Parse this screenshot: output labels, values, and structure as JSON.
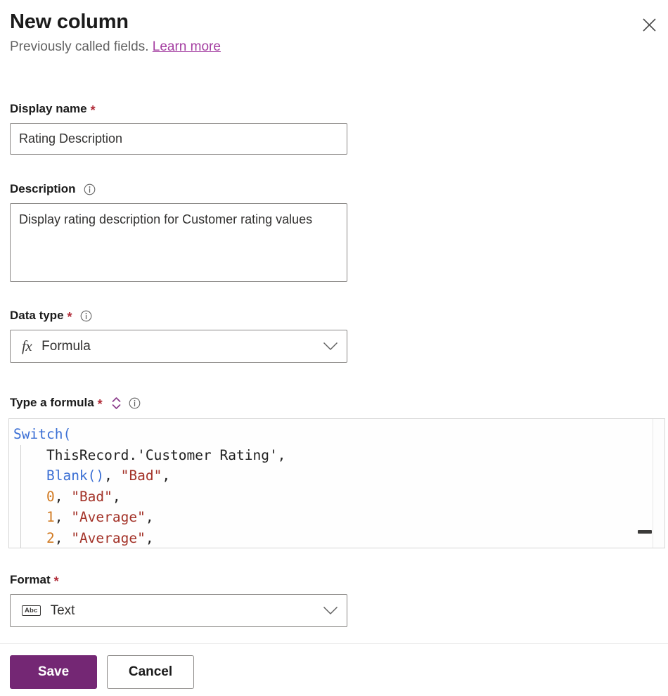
{
  "dialog": {
    "title": "New column",
    "subtitle_text": "Previously called fields.",
    "subtitle_link": "Learn more",
    "close_icon": "close-icon"
  },
  "colors": {
    "accent_purple": "#742774",
    "link_purple": "#a43ea1",
    "required_red": "#b02a37",
    "code_function": "#3b6fd4",
    "code_string": "#a33228",
    "code_number": "#d17a22",
    "code_plain": "#1f1f1f",
    "border_gray": "#8a8886"
  },
  "fields": {
    "display_name": {
      "label": "Display name",
      "required_marker": "*",
      "value": "Rating Description",
      "placeholder": ""
    },
    "description": {
      "label": "Description",
      "info_icon": "info-icon",
      "value": "Display rating description for Customer rating values",
      "placeholder": ""
    },
    "data_type": {
      "label": "Data type",
      "required_marker": "*",
      "info_icon": "info-icon",
      "selected": "Formula",
      "selected_icon_glyph": "fx",
      "selected_icon_name": "formula-fx-icon",
      "chevron_icon": "chevron-down-icon"
    },
    "formula": {
      "label": "Type a formula",
      "required_marker": "*",
      "expand_icon": "expand-collapse-icon",
      "info_icon": "info-icon",
      "lines": [
        [
          {
            "t": "Switch(",
            "c": "fn"
          }
        ],
        [
          {
            "t": "    ThisRecord.'Customer Rating',",
            "c": "plain"
          }
        ],
        [
          {
            "t": "    ",
            "c": "plain"
          },
          {
            "t": "Blank()",
            "c": "fn"
          },
          {
            "t": ", ",
            "c": "plain"
          },
          {
            "t": "\"Bad\"",
            "c": "str"
          },
          {
            "t": ",",
            "c": "plain"
          }
        ],
        [
          {
            "t": "    ",
            "c": "plain"
          },
          {
            "t": "0",
            "c": "num"
          },
          {
            "t": ", ",
            "c": "plain"
          },
          {
            "t": "\"Bad\"",
            "c": "str"
          },
          {
            "t": ",",
            "c": "plain"
          }
        ],
        [
          {
            "t": "    ",
            "c": "plain"
          },
          {
            "t": "1",
            "c": "num"
          },
          {
            "t": ", ",
            "c": "plain"
          },
          {
            "t": "\"Average\"",
            "c": "str"
          },
          {
            "t": ",",
            "c": "plain"
          }
        ],
        [
          {
            "t": "    ",
            "c": "plain"
          },
          {
            "t": "2",
            "c": "num"
          },
          {
            "t": ", ",
            "c": "plain"
          },
          {
            "t": "\"Average\"",
            "c": "str"
          },
          {
            "t": ",",
            "c": "plain"
          }
        ]
      ]
    },
    "format": {
      "label": "Format",
      "required_marker": "*",
      "selected": "Text",
      "selected_icon_glyph": "Abc",
      "selected_icon_name": "text-abc-icon",
      "chevron_icon": "chevron-down-icon"
    }
  },
  "footer": {
    "save_label": "Save",
    "cancel_label": "Cancel"
  }
}
